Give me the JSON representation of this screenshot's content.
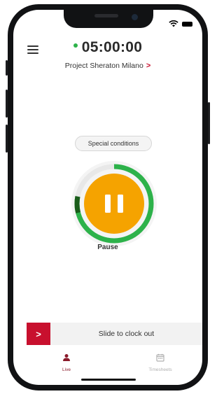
{
  "timer": {
    "value": "05:00:00",
    "status_color": "#2db24a"
  },
  "project": {
    "name": "Project Sheraton Milano",
    "chevron": ">"
  },
  "special_conditions": {
    "label": "Special conditions"
  },
  "progress": {
    "fraction": 0.78,
    "dark_segment_fraction": 0.07
  },
  "pause": {
    "label": "Pause",
    "button_color": "#f5a300"
  },
  "slider": {
    "handle_glyph": ">",
    "label": "Slide to clock out",
    "accent": "#c8102e"
  },
  "tabs": [
    {
      "label": "Live",
      "icon": "person-icon",
      "active": true
    },
    {
      "label": "Timesheets",
      "icon": "calendar-icon",
      "active": false
    }
  ]
}
